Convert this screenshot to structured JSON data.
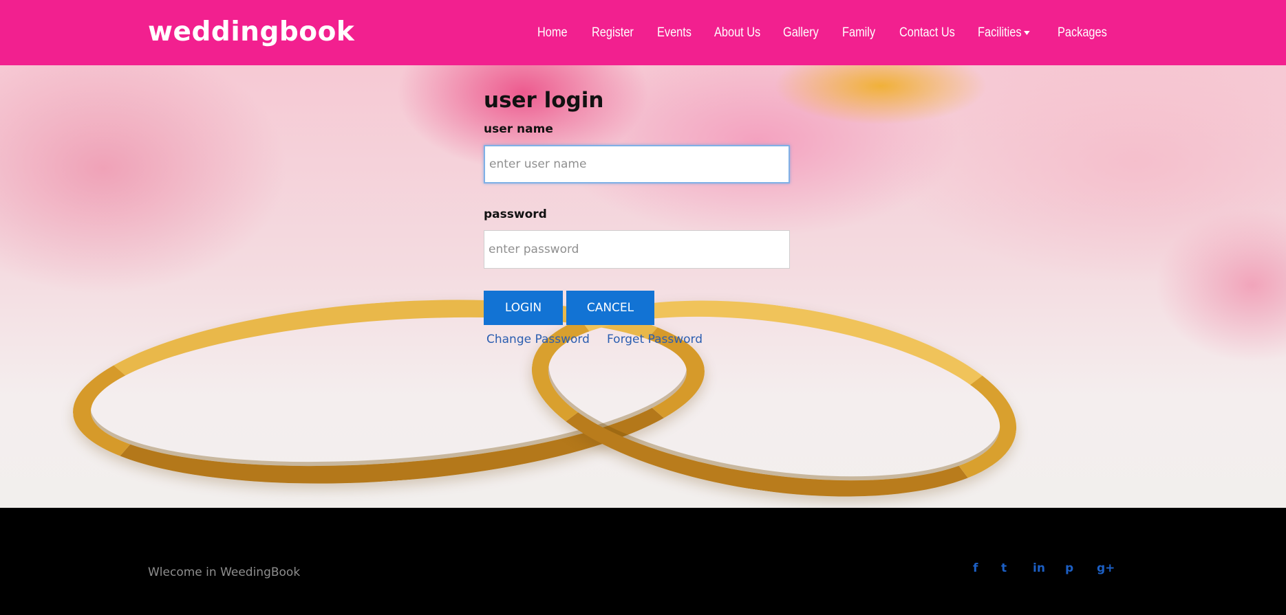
{
  "header": {
    "brand": "weddingbook",
    "nav": [
      {
        "label": "Home"
      },
      {
        "label": "Register"
      },
      {
        "label": "Events"
      },
      {
        "label": "About Us"
      },
      {
        "label": "Gallery"
      },
      {
        "label": "Family"
      },
      {
        "label": "Contact Us"
      },
      {
        "label": "Facilities"
      },
      {
        "label": "Packages"
      }
    ]
  },
  "login": {
    "title": "user login",
    "username_label": "user name",
    "username_placeholder": "enter user name",
    "password_label": "password",
    "password_placeholder": "enter password",
    "login_button": "LOGIN",
    "cancel_button": "CANCEL",
    "change_password": "Change Password",
    "forget_password": "Forget Password"
  },
  "footer": {
    "text": "Wlecome in WeedingBook",
    "social": {
      "facebook": "f",
      "twitter": "t",
      "linkedin": "in",
      "pinterest": "p",
      "googleplus": "g+"
    }
  },
  "colors": {
    "navbar": "#f2208f",
    "button": "#1273d4",
    "link": "#2a5db0",
    "footer": "#000000",
    "social_icon": "#1c5fc4"
  },
  "icons": [
    "chevron-down-icon",
    "facebook-icon",
    "twitter-icon",
    "linkedin-icon",
    "pinterest-icon",
    "googleplus-icon"
  ]
}
